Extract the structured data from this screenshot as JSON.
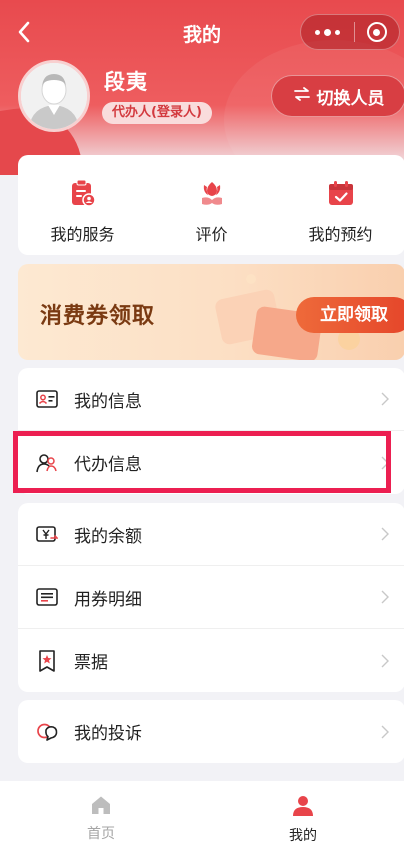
{
  "navbar": {
    "title": "我的",
    "back_icon": "chevron-left-icon",
    "more_icon": "more-dots-icon",
    "close_icon": "target-close-icon"
  },
  "profile": {
    "name": "段夷",
    "role": "代办人(登录人)",
    "switch_label": "切换人员",
    "switch_icon": "swap-arrows-icon"
  },
  "quick_actions": [
    {
      "label": "我的服务",
      "icon": "service-clipboard-icon"
    },
    {
      "label": "评价",
      "icon": "flower-hand-icon"
    },
    {
      "label": "我的预约",
      "icon": "calendar-check-icon"
    }
  ],
  "banner": {
    "title": "消费券领取",
    "button": "立即领取"
  },
  "menu_group_1": [
    {
      "label": "我的信息",
      "icon": "id-card-icon"
    },
    {
      "label": "代办信息",
      "icon": "people-icon"
    }
  ],
  "menu_group_2": [
    {
      "label": "我的余额",
      "icon": "yen-wallet-icon"
    },
    {
      "label": "用券明细",
      "icon": "list-detail-icon"
    },
    {
      "label": "票据",
      "icon": "ticket-star-icon"
    }
  ],
  "menu_group_3": [
    {
      "label": "我的投诉",
      "icon": "complaint-bubble-icon"
    }
  ],
  "tabbar": [
    {
      "label": "首页",
      "icon": "home-icon",
      "active": false
    },
    {
      "label": "我的",
      "icon": "user-icon",
      "active": true
    }
  ],
  "colors": {
    "brand_red": "#e84a4e",
    "highlight_border": "#ec1f51",
    "banner_button": "#e5452a"
  }
}
